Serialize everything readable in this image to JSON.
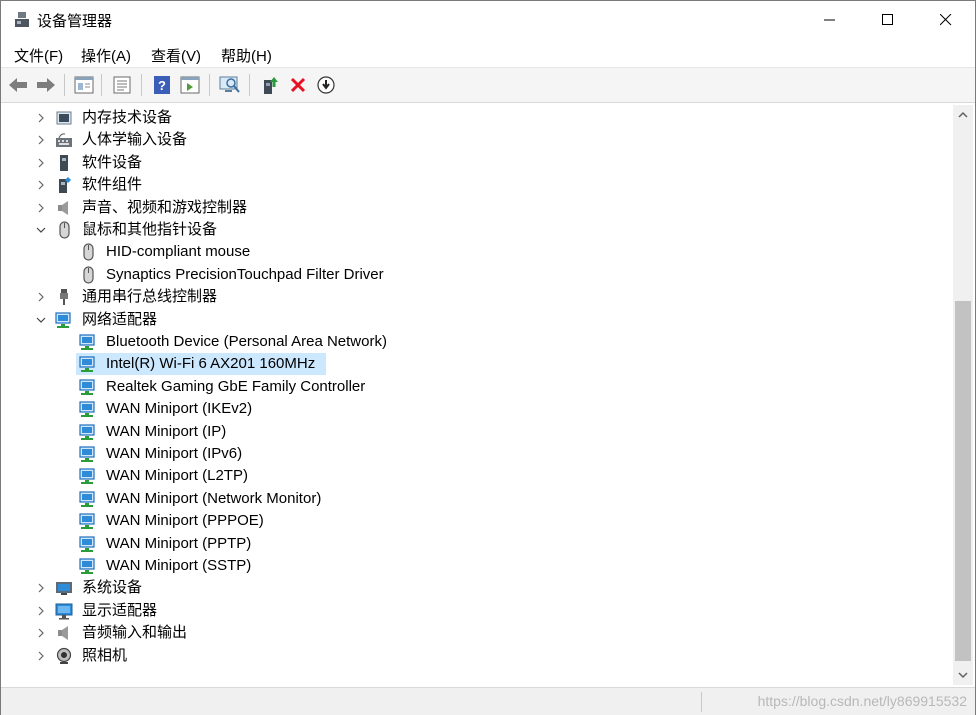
{
  "window": {
    "title": "设备管理器"
  },
  "menu": [
    {
      "label": "文件(F)"
    },
    {
      "label": "操作(A)"
    },
    {
      "label": "查看(V)"
    },
    {
      "label": "帮助(H)"
    }
  ],
  "toolbar": {
    "buttons": [
      "back-icon",
      "forward-icon",
      "properties-icon",
      "list-icon",
      "help-icon",
      "show-hidden-icon",
      "scan-hardware-icon",
      "update-driver-icon",
      "uninstall-icon",
      "disable-icon"
    ]
  },
  "tree": [
    {
      "label": "内存技术设备",
      "icon": "memory-icon",
      "state": "collapsed"
    },
    {
      "label": "人体学输入设备",
      "icon": "hid-icon",
      "state": "collapsed"
    },
    {
      "label": "软件设备",
      "icon": "software-device-icon",
      "state": "collapsed"
    },
    {
      "label": "软件组件",
      "icon": "software-component-icon",
      "state": "collapsed"
    },
    {
      "label": "声音、视频和游戏控制器",
      "icon": "speaker-icon",
      "state": "collapsed"
    },
    {
      "label": "鼠标和其他指针设备",
      "icon": "mouse-icon",
      "state": "expanded",
      "children": [
        {
          "label": "HID-compliant mouse",
          "icon": "mouse-icon"
        },
        {
          "label": "Synaptics PrecisionTouchpad Filter Driver",
          "icon": "mouse-icon"
        }
      ]
    },
    {
      "label": "通用串行总线控制器",
      "icon": "usb-icon",
      "state": "collapsed"
    },
    {
      "label": "网络适配器",
      "icon": "network-icon",
      "state": "expanded",
      "children": [
        {
          "label": "Bluetooth Device (Personal Area Network)",
          "icon": "network-icon"
        },
        {
          "label": "Intel(R) Wi-Fi 6 AX201 160MHz",
          "icon": "network-icon",
          "selected": true
        },
        {
          "label": "Realtek Gaming GbE Family Controller",
          "icon": "network-icon"
        },
        {
          "label": "WAN Miniport (IKEv2)",
          "icon": "network-icon"
        },
        {
          "label": "WAN Miniport (IP)",
          "icon": "network-icon"
        },
        {
          "label": "WAN Miniport (IPv6)",
          "icon": "network-icon"
        },
        {
          "label": "WAN Miniport (L2TP)",
          "icon": "network-icon"
        },
        {
          "label": "WAN Miniport (Network Monitor)",
          "icon": "network-icon"
        },
        {
          "label": "WAN Miniport (PPPOE)",
          "icon": "network-icon"
        },
        {
          "label": "WAN Miniport (PPTP)",
          "icon": "network-icon"
        },
        {
          "label": "WAN Miniport (SSTP)",
          "icon": "network-icon"
        }
      ]
    },
    {
      "label": "系统设备",
      "icon": "system-icon",
      "state": "collapsed"
    },
    {
      "label": "显示适配器",
      "icon": "display-icon",
      "state": "collapsed"
    },
    {
      "label": "音频输入和输出",
      "icon": "speaker-icon",
      "state": "collapsed"
    },
    {
      "label": "照相机",
      "icon": "camera-icon",
      "state": "collapsed"
    }
  ],
  "watermark": "https://blog.csdn.net/ly869915532",
  "colors": {
    "selection": "#cce8ff",
    "network": "#2e8bd8",
    "delete": "#e81123"
  }
}
